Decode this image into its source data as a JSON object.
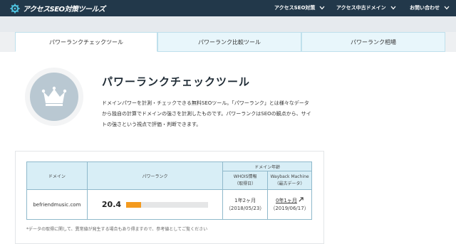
{
  "header": {
    "logo_text": "アクセスSEO対策ツールズ",
    "nav": [
      {
        "label": "アクセスSEO対策"
      },
      {
        "label": "アクセス中古ドメイン"
      },
      {
        "label": "お問い合わせ"
      }
    ]
  },
  "tabs": [
    {
      "label": "パワーランクチェックツール",
      "active": true
    },
    {
      "label": "パワーランク比較ツール",
      "active": false
    },
    {
      "label": "パワーランク相場",
      "active": false
    }
  ],
  "tool": {
    "title": "パワーランクチェックツール",
    "description": "ドメインパワーを計測・チェックできる無料SEOツール。「パワーランク」とは様々なデータから独自の計算でドメインの強さを計測したものです。パワーランクはSEOの観点から、サイトの強さという視点で評価・判断できます。"
  },
  "table": {
    "col_domain": "ドメイン",
    "col_power": "パワーランク",
    "col_age": "ドメイン年齢",
    "col_whois_line1": "WHOIS情報",
    "col_whois_line2": "（取得日）",
    "col_wb_line1": "Wayback Machine",
    "col_wb_line2": "（最古データ）",
    "row": {
      "domain": "befriendmusic.com",
      "power_rank": "20.4",
      "power_rank_fraction": 0.18,
      "whois_age": "1年2ヶ月",
      "whois_date": "（2018/05/23）",
      "wb_age": "0年1ヶ月",
      "wb_date": "（2019/06/17）"
    }
  },
  "note": "*データの取得に関して、異常値が発生する場合もあり得ますので、参考値としてご覧ください",
  "colors": {
    "nav_bg": "#22384a",
    "tab_bg": "#e8f6fb",
    "table_header": "#d8eef6",
    "bar_fill": "#f39a1e",
    "crown_bg": "#b9c8d2"
  },
  "icons": {
    "logo": "gear-logo-icon",
    "nav_chevron": "chevron-down-icon",
    "crown": "crown-icon",
    "external": "external-link-icon"
  }
}
